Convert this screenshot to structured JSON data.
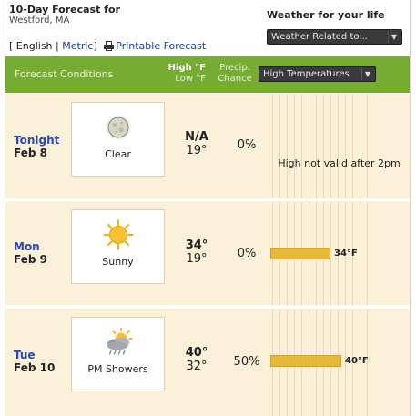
{
  "header": {
    "title": "10-Day Forecast for",
    "location": "Westford, MA",
    "weather_life_label": "Weather for your life",
    "weather_life_select": "Weather Related to..."
  },
  "langbar": {
    "open_bracket": "[",
    "english": "English",
    "sep": "|",
    "metric": "Metric",
    "close_bracket": "]",
    "printable": "Printable Forecast"
  },
  "table_header": {
    "conditions": "Forecast Conditions",
    "high_label": "High °F",
    "low_label": "Low °F",
    "precip_line1": "Precip.",
    "precip_line2": "Chance",
    "graph_select": "High Temperatures"
  },
  "rows": [
    {
      "day": "Tonight",
      "date": "Feb 8",
      "condition": "Clear",
      "icon": "clear-night-moon-icon",
      "high": "N/A",
      "low": "19°",
      "precip": "0%",
      "graph_note": "High not valid after 2pm",
      "bar_value": null,
      "bar_label": ""
    },
    {
      "day": "Mon",
      "date": "Feb 9",
      "condition": "Sunny",
      "icon": "sunny-icon",
      "high": "34°",
      "low": "19°",
      "precip": "0%",
      "graph_note": "",
      "bar_value": 34,
      "bar_label": "34°F"
    },
    {
      "day": "Tue",
      "date": "Feb 10",
      "condition": "PM Showers",
      "icon": "pm-showers-icon",
      "high": "40°",
      "low": "32°",
      "precip": "50%",
      "graph_note": "",
      "bar_value": 40,
      "bar_label": "40°F"
    }
  ],
  "colors": {
    "header_green": "#77ac33",
    "row_bg": "#fbf1d9",
    "bar": "#e6b93a",
    "day_link": "#2b48b5"
  }
}
